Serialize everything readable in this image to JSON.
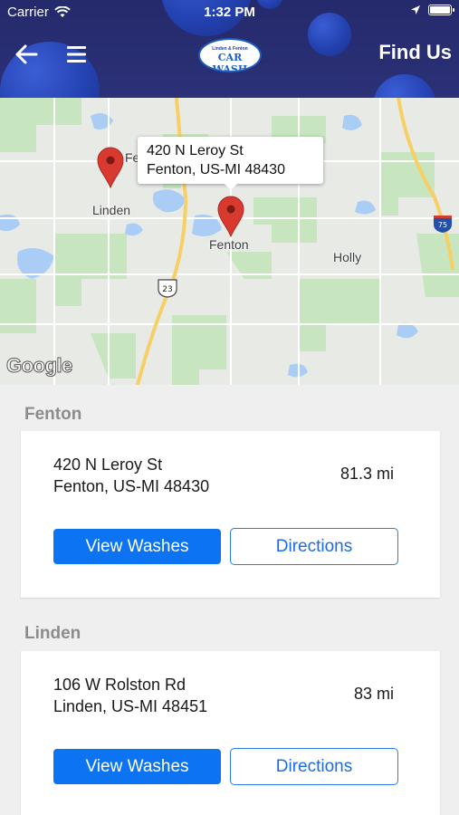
{
  "status_bar": {
    "carrier": "Carrier",
    "time": "1:32 PM"
  },
  "header": {
    "title": "Find Us",
    "logo_top": "Linden & Fenton",
    "logo_main": "CAR WASH",
    "back_icon": "back-arrow-icon",
    "menu_icon": "hamburger-menu-icon"
  },
  "map": {
    "callout": {
      "line1": "420 N Leroy St",
      "line2": "Fenton, US-MI  48430"
    },
    "labels": {
      "linden": "Linden",
      "fenton": "Fenton",
      "holly": "Holly",
      "fe_partial": "Fe",
      "google": "Google"
    },
    "shields": {
      "us23": "23",
      "i75": "75"
    }
  },
  "locations": [
    {
      "section": "Fenton",
      "address_line1": "420 N Leroy St",
      "address_line2": "Fenton, US-MI  48430",
      "distance": "81.3 mi",
      "view_label": "View Washes",
      "directions_label": "Directions"
    },
    {
      "section": "Linden",
      "address_line1": "106 W Rolston Rd",
      "address_line2": "Linden, US-MI  48451",
      "distance": "83 mi",
      "view_label": "View Washes",
      "directions_label": "Directions"
    }
  ],
  "colors": {
    "header_bg": "#2a2f74",
    "primary_button": "#0c73f2",
    "pin": "#d93a2f",
    "section_title": "#8c8c8c"
  }
}
